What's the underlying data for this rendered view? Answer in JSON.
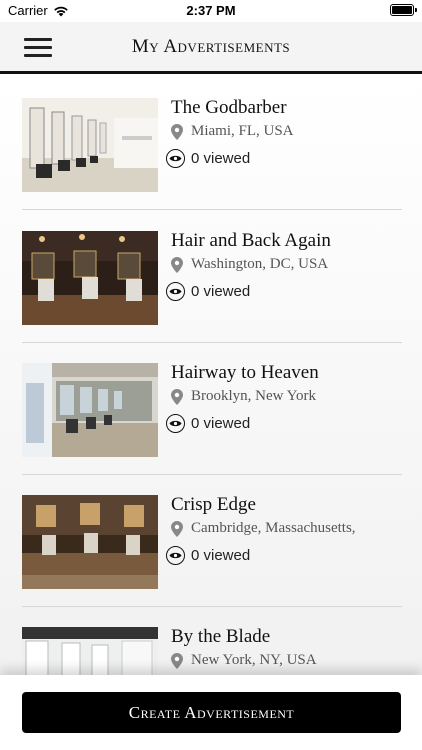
{
  "status_bar": {
    "carrier": "Carrier",
    "time": "2:37 PM"
  },
  "nav": {
    "title": "My Advertisements",
    "menu_icon": "hamburger-menu-icon"
  },
  "ads": [
    {
      "title": "The Godbarber",
      "location": "Miami, FL, USA",
      "views": "0 viewed"
    },
    {
      "title": "Hair and Back Again",
      "location": "Washington, DC, USA",
      "views": "0 viewed"
    },
    {
      "title": "Hairway to Heaven",
      "location": "Brooklyn, New York",
      "views": "0 viewed"
    },
    {
      "title": "Crisp Edge",
      "location": "Cambridge, Massachusetts,",
      "views": "0 viewed"
    },
    {
      "title": "By the Blade",
      "location": "New York, NY, USA",
      "views": ""
    }
  ],
  "footer": {
    "create_label": "Create Advertisement"
  },
  "icons": {
    "location": "map-pin-icon",
    "views": "eye-icon"
  },
  "colors": {
    "accent": "#000000",
    "divider": "#d7d7d7",
    "secondary_text": "#555555"
  }
}
